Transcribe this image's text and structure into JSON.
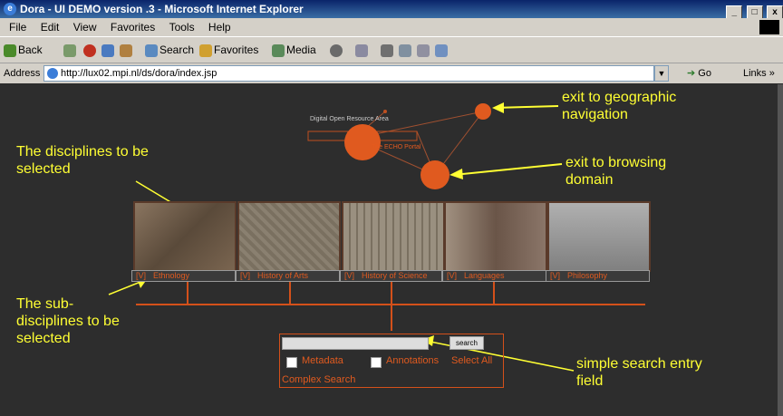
{
  "window": {
    "title": "Dora - UI DEMO version .3 - Microsoft Internet Explorer",
    "min": "_",
    "max": "□",
    "close": "x"
  },
  "menu": [
    "File",
    "Edit",
    "View",
    "Favorites",
    "Tools",
    "Help"
  ],
  "toolbar": {
    "back": "Back",
    "search": "Search",
    "favorites": "Favorites",
    "media": "Media"
  },
  "address": {
    "label": "Address",
    "url": "http://lux02.mpi.nl/ds/dora/index.jsp",
    "go": "Go",
    "links": "Links"
  },
  "portal": {
    "logo_title": "Digital Open Resource Area",
    "logo_sub": "The ECHO Portal"
  },
  "disciplines": [
    {
      "label": "Ethnology",
      "v": "[V]"
    },
    {
      "label": "History of Arts",
      "v": "[V]"
    },
    {
      "label": "History of Science",
      "v": "[V]"
    },
    {
      "label": "Languages",
      "v": "[V]"
    },
    {
      "label": "Philosophy",
      "v": "[V]"
    }
  ],
  "search": {
    "button": "search",
    "metadata": "Metadata",
    "annotations": "Annotations",
    "select_all": "Select All",
    "complex": "Complex Search"
  },
  "annotations": {
    "geo": "exit to geographic navigation",
    "browse": "exit to browsing domain",
    "disc": "The disciplines to be selected",
    "subdisc": "The sub-disciplines to be selected",
    "search_field": "simple search entry field"
  },
  "colors": {
    "accent": "#e05a1f",
    "annotation": "#ffff33",
    "background": "#2d2d2d"
  }
}
